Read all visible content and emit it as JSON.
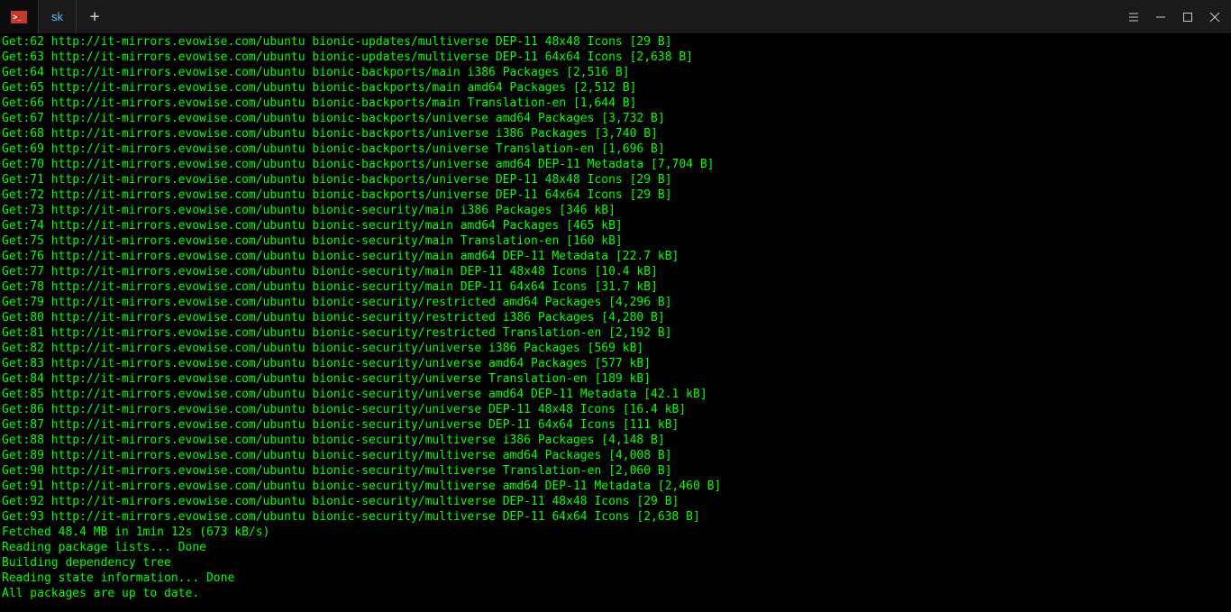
{
  "titlebar": {
    "tab_label": "sk",
    "newtab_glyph": "+"
  },
  "lines": [
    "Get:62 http://it-mirrors.evowise.com/ubuntu bionic-updates/multiverse DEP-11 48x48 Icons [29 B]",
    "Get:63 http://it-mirrors.evowise.com/ubuntu bionic-updates/multiverse DEP-11 64x64 Icons [2,638 B]",
    "Get:64 http://it-mirrors.evowise.com/ubuntu bionic-backports/main i386 Packages [2,516 B]",
    "Get:65 http://it-mirrors.evowise.com/ubuntu bionic-backports/main amd64 Packages [2,512 B]",
    "Get:66 http://it-mirrors.evowise.com/ubuntu bionic-backports/main Translation-en [1,644 B]",
    "Get:67 http://it-mirrors.evowise.com/ubuntu bionic-backports/universe amd64 Packages [3,732 B]",
    "Get:68 http://it-mirrors.evowise.com/ubuntu bionic-backports/universe i386 Packages [3,740 B]",
    "Get:69 http://it-mirrors.evowise.com/ubuntu bionic-backports/universe Translation-en [1,696 B]",
    "Get:70 http://it-mirrors.evowise.com/ubuntu bionic-backports/universe amd64 DEP-11 Metadata [7,704 B]",
    "Get:71 http://it-mirrors.evowise.com/ubuntu bionic-backports/universe DEP-11 48x48 Icons [29 B]",
    "Get:72 http://it-mirrors.evowise.com/ubuntu bionic-backports/universe DEP-11 64x64 Icons [29 B]",
    "Get:73 http://it-mirrors.evowise.com/ubuntu bionic-security/main i386 Packages [346 kB]",
    "Get:74 http://it-mirrors.evowise.com/ubuntu bionic-security/main amd64 Packages [465 kB]",
    "Get:75 http://it-mirrors.evowise.com/ubuntu bionic-security/main Translation-en [160 kB]",
    "Get:76 http://it-mirrors.evowise.com/ubuntu bionic-security/main amd64 DEP-11 Metadata [22.7 kB]",
    "Get:77 http://it-mirrors.evowise.com/ubuntu bionic-security/main DEP-11 48x48 Icons [10.4 kB]",
    "Get:78 http://it-mirrors.evowise.com/ubuntu bionic-security/main DEP-11 64x64 Icons [31.7 kB]",
    "Get:79 http://it-mirrors.evowise.com/ubuntu bionic-security/restricted amd64 Packages [4,296 B]",
    "Get:80 http://it-mirrors.evowise.com/ubuntu bionic-security/restricted i386 Packages [4,280 B]",
    "Get:81 http://it-mirrors.evowise.com/ubuntu bionic-security/restricted Translation-en [2,192 B]",
    "Get:82 http://it-mirrors.evowise.com/ubuntu bionic-security/universe i386 Packages [569 kB]",
    "Get:83 http://it-mirrors.evowise.com/ubuntu bionic-security/universe amd64 Packages [577 kB]",
    "Get:84 http://it-mirrors.evowise.com/ubuntu bionic-security/universe Translation-en [189 kB]",
    "Get:85 http://it-mirrors.evowise.com/ubuntu bionic-security/universe amd64 DEP-11 Metadata [42.1 kB]",
    "Get:86 http://it-mirrors.evowise.com/ubuntu bionic-security/universe DEP-11 48x48 Icons [16.4 kB]",
    "Get:87 http://it-mirrors.evowise.com/ubuntu bionic-security/universe DEP-11 64x64 Icons [111 kB]",
    "Get:88 http://it-mirrors.evowise.com/ubuntu bionic-security/multiverse i386 Packages [4,148 B]",
    "Get:89 http://it-mirrors.evowise.com/ubuntu bionic-security/multiverse amd64 Packages [4,008 B]",
    "Get:90 http://it-mirrors.evowise.com/ubuntu bionic-security/multiverse Translation-en [2,060 B]",
    "Get:91 http://it-mirrors.evowise.com/ubuntu bionic-security/multiverse amd64 DEP-11 Metadata [2,460 B]",
    "Get:92 http://it-mirrors.evowise.com/ubuntu bionic-security/multiverse DEP-11 48x48 Icons [29 B]",
    "Get:93 http://it-mirrors.evowise.com/ubuntu bionic-security/multiverse DEP-11 64x64 Icons [2,638 B]",
    "Fetched 48.4 MB in 1min 12s (673 kB/s)",
    "Reading package lists... Done",
    "Building dependency tree",
    "Reading state information... Done",
    "All packages are up to date."
  ]
}
